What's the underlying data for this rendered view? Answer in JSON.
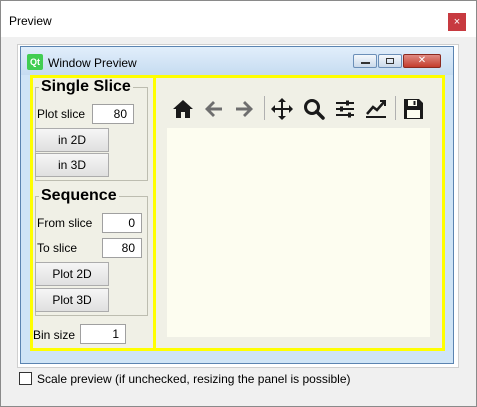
{
  "window": {
    "title": "Preview",
    "close_glyph": "×"
  },
  "qt_window": {
    "logo": "Qt",
    "title": "Window Preview",
    "close_glyph": "✕"
  },
  "single_slice": {
    "title": "Single Slice",
    "plot_slice_label": "Plot slice",
    "plot_slice_value": "80",
    "btn_2d": "in 2D",
    "btn_3d": "in 3D"
  },
  "sequence": {
    "title": "Sequence",
    "from_label": "From slice",
    "from_value": "0",
    "to_label": "To slice",
    "to_value": "80",
    "btn_2d": "Plot 2D",
    "btn_3d": "Plot 3D"
  },
  "bin": {
    "label": "Bin size",
    "value": "1"
  },
  "toolbar": {
    "icons": [
      "home-icon",
      "arrow-left-icon",
      "arrow-right-icon",
      "move-icon",
      "zoom-icon",
      "sliders-icon",
      "line-chart-icon",
      "save-icon"
    ]
  },
  "scale": {
    "label": "Scale preview (if unchecked, resizing the panel is possible)",
    "checked": false
  },
  "colors": {
    "yellow_border": "#ffff00",
    "panel_bg": "#f0f0e6",
    "plot_bg": "#fdfdf0",
    "close_red": "#c73a40"
  }
}
